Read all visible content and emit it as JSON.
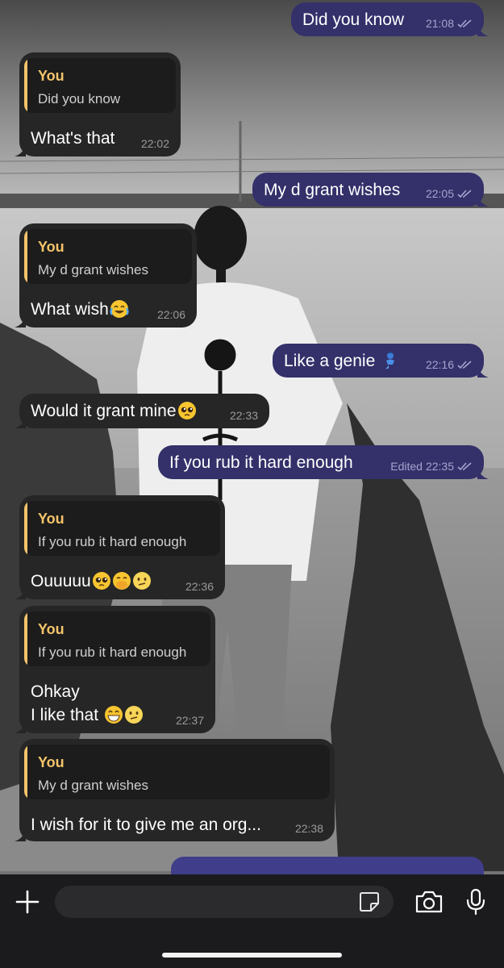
{
  "conversation": {
    "messages": [
      {
        "direction": "outgoing",
        "text": "Did you know",
        "time": "21:08",
        "status": "read"
      },
      {
        "direction": "incoming",
        "reply": {
          "author": "You",
          "quote": "Did you know"
        },
        "text": "What's that",
        "time": "22:02"
      },
      {
        "direction": "outgoing",
        "text": "My d grant wishes",
        "time": "22:05",
        "status": "read"
      },
      {
        "direction": "incoming",
        "reply": {
          "author": "You",
          "quote": "My d grant wishes"
        },
        "text": "What wish",
        "emojis": [
          "face-with-tears-of-joy"
        ],
        "time": "22:06"
      },
      {
        "direction": "outgoing",
        "text": "Like a genie",
        "emojis": [
          "genie"
        ],
        "time": "22:16",
        "status": "read"
      },
      {
        "direction": "incoming",
        "text": "Would it grant mine",
        "emojis": [
          "pleading-face"
        ],
        "time": "22:33"
      },
      {
        "direction": "outgoing",
        "text": "If you rub it hard enough",
        "edited_label": "Edited",
        "time": "22:35",
        "status": "read"
      },
      {
        "direction": "incoming",
        "reply": {
          "author": "You",
          "quote": "If you rub it hard enough"
        },
        "text": "Ouuuuu",
        "emojis": [
          "pleading-face",
          "face-with-hand-over-mouth",
          "face-with-diagonal-mouth"
        ],
        "time": "22:36"
      },
      {
        "direction": "incoming",
        "reply": {
          "author": "You",
          "quote": "If you rub it hard enough"
        },
        "text": "Ohkay",
        "text_line2": "I like that",
        "emojis": [
          "beaming-face",
          "face-with-diagonal-mouth"
        ],
        "time": "22:37"
      },
      {
        "direction": "incoming",
        "reply": {
          "author": "You",
          "quote": "My d grant wishes"
        },
        "text": "I wish for it to give me an org...",
        "time": "22:38"
      }
    ]
  },
  "composer": {
    "attach_icon": "plus-icon",
    "placeholder": "",
    "sticker_icon": "sticker-icon",
    "camera_icon": "camera-icon",
    "mic_icon": "microphone-icon"
  },
  "colors": {
    "outgoing_bubble": "#33306a",
    "incoming_bubble": "#262626",
    "reply_accent": "#f4c46a"
  },
  "background": "grayscale wallpaper photo"
}
